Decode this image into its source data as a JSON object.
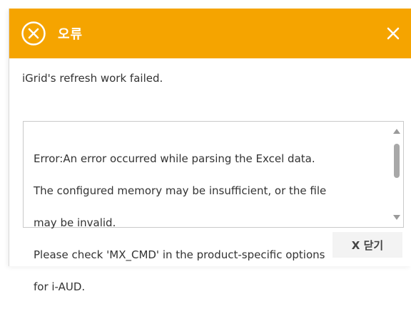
{
  "dialog": {
    "title": "오류",
    "message": "iGrid's refresh work failed.",
    "detail_lines": [
      "Error:An error occurred while parsing the Excel data.",
      "The configured memory may be insufficient, or the file",
      "may be invalid.",
      "Please check 'MX_CMD' in the product-specific options",
      "for i-AUD."
    ],
    "close_button_label": "X 닫기"
  },
  "icons": {
    "title": "error-circle-x-icon",
    "close": "close-x-icon",
    "scroll_up": "triangle-up-icon",
    "scroll_down": "triangle-down-icon"
  },
  "colors": {
    "titlebar": "#f5a400",
    "title_text": "#ffffff",
    "text": "#333333",
    "button_bg": "#f3f3f3"
  }
}
